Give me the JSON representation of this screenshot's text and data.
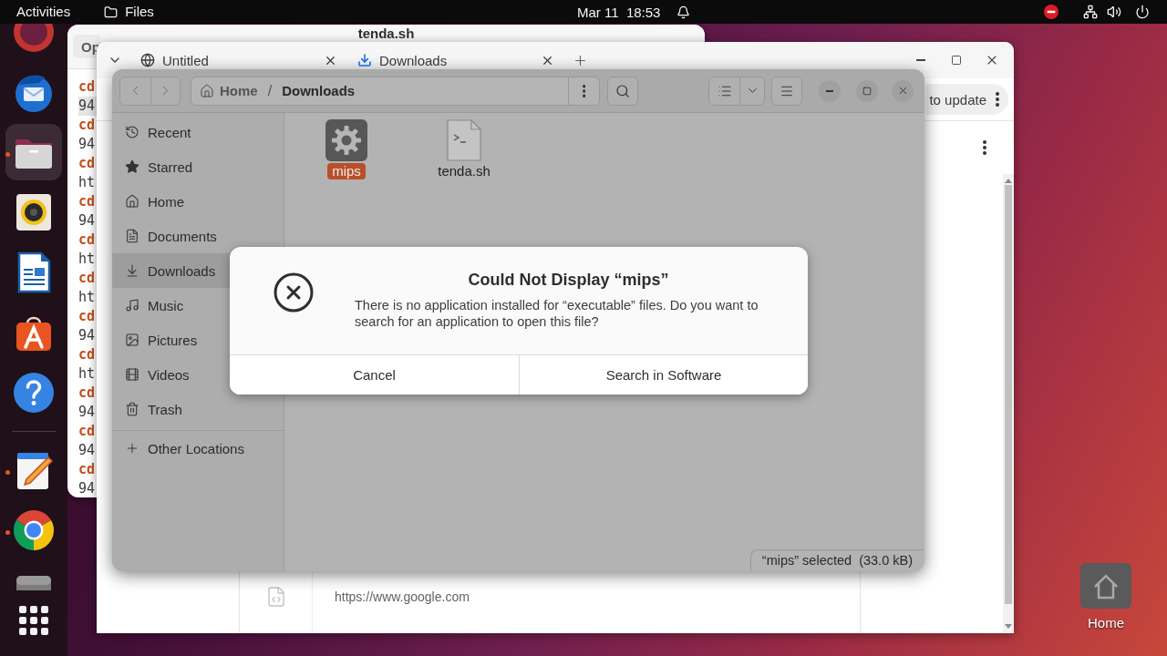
{
  "top_bar": {
    "activities": "Activities",
    "app_menu": "Files",
    "clock": "Mar 11  18:53"
  },
  "dock": {
    "groups": [
      {
        "items": [
          {
            "kind": "circle",
            "running": false,
            "focused": false
          },
          {
            "kind": "mail",
            "running": false,
            "focused": false
          },
          {
            "kind": "files",
            "running": true,
            "focused": true
          },
          {
            "kind": "music",
            "running": false,
            "focused": false
          },
          {
            "kind": "writer",
            "running": false,
            "focused": false
          },
          {
            "kind": "store",
            "running": false,
            "focused": false
          },
          {
            "kind": "help",
            "running": false,
            "focused": false
          }
        ]
      },
      {
        "items": [
          {
            "kind": "editor",
            "running": true,
            "focused": false
          },
          {
            "kind": "browser",
            "running": true,
            "focused": false
          },
          {
            "kind": "drive",
            "running": false,
            "focused": false
          }
        ]
      }
    ]
  },
  "text_editor": {
    "open_button": "Op",
    "title": "tenda.sh",
    "lines": [
      {
        "kind": "command",
        "text": "cd",
        "current": false
      },
      {
        "kind": "output",
        "text": "94",
        "current": true
      },
      {
        "kind": "command",
        "text": "cd",
        "current": false
      },
      {
        "kind": "output",
        "text": "94",
        "current": false
      },
      {
        "kind": "command",
        "text": "cd",
        "current": false
      },
      {
        "kind": "output",
        "text": "ht",
        "current": false
      },
      {
        "kind": "command",
        "text": "cd",
        "current": false
      },
      {
        "kind": "output",
        "text": "94",
        "current": false
      },
      {
        "kind": "command",
        "text": "cd",
        "current": false
      },
      {
        "kind": "output",
        "text": "ht",
        "current": false
      },
      {
        "kind": "command",
        "text": "cd",
        "current": false
      },
      {
        "kind": "output",
        "text": "ht",
        "current": false
      },
      {
        "kind": "command",
        "text": "cd",
        "current": false
      },
      {
        "kind": "output",
        "text": "94",
        "current": false
      },
      {
        "kind": "command",
        "text": "cd",
        "current": false
      },
      {
        "kind": "output",
        "text": "ht",
        "current": false
      },
      {
        "kind": "command",
        "text": "cd",
        "current": false
      },
      {
        "kind": "output",
        "text": "94",
        "current": false
      },
      {
        "kind": "command",
        "text": "cd",
        "current": false
      },
      {
        "kind": "output",
        "text": "94",
        "current": false
      },
      {
        "kind": "command",
        "text": "cd",
        "current": false
      },
      {
        "kind": "output",
        "text": "94",
        "current": false
      }
    ]
  },
  "browser": {
    "tabs": [
      {
        "kind": "web",
        "title": "Untitled"
      },
      {
        "kind": "download",
        "title": "Downloads"
      }
    ],
    "update_chip": "to update",
    "downloads": [
      {
        "url": "https://www.google.com"
      }
    ]
  },
  "files_window": {
    "path": [
      {
        "kind": "home",
        "label": "Home",
        "current": false
      },
      {
        "kind": "folder",
        "label": "Downloads",
        "current": true
      }
    ],
    "path_separator": "/",
    "sidebar": [
      {
        "kind": "recent",
        "label": "Recent",
        "selected": false
      },
      {
        "kind": "starred",
        "label": "Starred",
        "selected": false
      },
      {
        "kind": "home",
        "label": "Home",
        "selected": false
      },
      {
        "kind": "documents",
        "label": "Documents",
        "selected": false
      },
      {
        "kind": "downloads",
        "label": "Downloads",
        "selected": true
      },
      {
        "kind": "music",
        "label": "Music",
        "selected": false
      },
      {
        "kind": "pictures",
        "label": "Pictures",
        "selected": false
      },
      {
        "kind": "videos",
        "label": "Videos",
        "selected": false
      },
      {
        "kind": "trash",
        "label": "Trash",
        "selected": false
      }
    ],
    "other_locations": "Other Locations",
    "items": [
      {
        "kind": "executable",
        "name": "mips",
        "selected": true
      },
      {
        "kind": "script",
        "name": "tenda.sh",
        "selected": false
      }
    ],
    "status": "“mips” selected  (33.0 kB)"
  },
  "dialog": {
    "title": "Could Not Display “mips”",
    "message": "There is no application installed for “executable” files. Do you want to search for an application to open this file?",
    "buttons": [
      {
        "label": "Cancel"
      },
      {
        "label": "Search in Software"
      }
    ]
  },
  "desktop_icons": [
    {
      "kind": "home",
      "label": "Home"
    }
  ]
}
